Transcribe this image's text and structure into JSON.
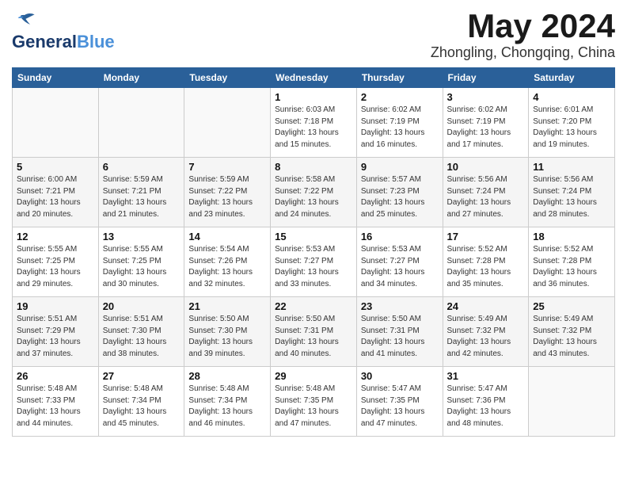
{
  "logo": {
    "text_general": "General",
    "text_blue": "Blue"
  },
  "header": {
    "title": "May 2024",
    "subtitle": "Zhongling, Chongqing, China"
  },
  "days_of_week": [
    "Sunday",
    "Monday",
    "Tuesday",
    "Wednesday",
    "Thursday",
    "Friday",
    "Saturday"
  ],
  "weeks": [
    [
      {
        "day": "",
        "info": ""
      },
      {
        "day": "",
        "info": ""
      },
      {
        "day": "",
        "info": ""
      },
      {
        "day": "1",
        "info": "Sunrise: 6:03 AM\nSunset: 7:18 PM\nDaylight: 13 hours\nand 15 minutes."
      },
      {
        "day": "2",
        "info": "Sunrise: 6:02 AM\nSunset: 7:19 PM\nDaylight: 13 hours\nand 16 minutes."
      },
      {
        "day": "3",
        "info": "Sunrise: 6:02 AM\nSunset: 7:19 PM\nDaylight: 13 hours\nand 17 minutes."
      },
      {
        "day": "4",
        "info": "Sunrise: 6:01 AM\nSunset: 7:20 PM\nDaylight: 13 hours\nand 19 minutes."
      }
    ],
    [
      {
        "day": "5",
        "info": "Sunrise: 6:00 AM\nSunset: 7:21 PM\nDaylight: 13 hours\nand 20 minutes."
      },
      {
        "day": "6",
        "info": "Sunrise: 5:59 AM\nSunset: 7:21 PM\nDaylight: 13 hours\nand 21 minutes."
      },
      {
        "day": "7",
        "info": "Sunrise: 5:59 AM\nSunset: 7:22 PM\nDaylight: 13 hours\nand 23 minutes."
      },
      {
        "day": "8",
        "info": "Sunrise: 5:58 AM\nSunset: 7:22 PM\nDaylight: 13 hours\nand 24 minutes."
      },
      {
        "day": "9",
        "info": "Sunrise: 5:57 AM\nSunset: 7:23 PM\nDaylight: 13 hours\nand 25 minutes."
      },
      {
        "day": "10",
        "info": "Sunrise: 5:56 AM\nSunset: 7:24 PM\nDaylight: 13 hours\nand 27 minutes."
      },
      {
        "day": "11",
        "info": "Sunrise: 5:56 AM\nSunset: 7:24 PM\nDaylight: 13 hours\nand 28 minutes."
      }
    ],
    [
      {
        "day": "12",
        "info": "Sunrise: 5:55 AM\nSunset: 7:25 PM\nDaylight: 13 hours\nand 29 minutes."
      },
      {
        "day": "13",
        "info": "Sunrise: 5:55 AM\nSunset: 7:25 PM\nDaylight: 13 hours\nand 30 minutes."
      },
      {
        "day": "14",
        "info": "Sunrise: 5:54 AM\nSunset: 7:26 PM\nDaylight: 13 hours\nand 32 minutes."
      },
      {
        "day": "15",
        "info": "Sunrise: 5:53 AM\nSunset: 7:27 PM\nDaylight: 13 hours\nand 33 minutes."
      },
      {
        "day": "16",
        "info": "Sunrise: 5:53 AM\nSunset: 7:27 PM\nDaylight: 13 hours\nand 34 minutes."
      },
      {
        "day": "17",
        "info": "Sunrise: 5:52 AM\nSunset: 7:28 PM\nDaylight: 13 hours\nand 35 minutes."
      },
      {
        "day": "18",
        "info": "Sunrise: 5:52 AM\nSunset: 7:28 PM\nDaylight: 13 hours\nand 36 minutes."
      }
    ],
    [
      {
        "day": "19",
        "info": "Sunrise: 5:51 AM\nSunset: 7:29 PM\nDaylight: 13 hours\nand 37 minutes."
      },
      {
        "day": "20",
        "info": "Sunrise: 5:51 AM\nSunset: 7:30 PM\nDaylight: 13 hours\nand 38 minutes."
      },
      {
        "day": "21",
        "info": "Sunrise: 5:50 AM\nSunset: 7:30 PM\nDaylight: 13 hours\nand 39 minutes."
      },
      {
        "day": "22",
        "info": "Sunrise: 5:50 AM\nSunset: 7:31 PM\nDaylight: 13 hours\nand 40 minutes."
      },
      {
        "day": "23",
        "info": "Sunrise: 5:50 AM\nSunset: 7:31 PM\nDaylight: 13 hours\nand 41 minutes."
      },
      {
        "day": "24",
        "info": "Sunrise: 5:49 AM\nSunset: 7:32 PM\nDaylight: 13 hours\nand 42 minutes."
      },
      {
        "day": "25",
        "info": "Sunrise: 5:49 AM\nSunset: 7:32 PM\nDaylight: 13 hours\nand 43 minutes."
      }
    ],
    [
      {
        "day": "26",
        "info": "Sunrise: 5:48 AM\nSunset: 7:33 PM\nDaylight: 13 hours\nand 44 minutes."
      },
      {
        "day": "27",
        "info": "Sunrise: 5:48 AM\nSunset: 7:34 PM\nDaylight: 13 hours\nand 45 minutes."
      },
      {
        "day": "28",
        "info": "Sunrise: 5:48 AM\nSunset: 7:34 PM\nDaylight: 13 hours\nand 46 minutes."
      },
      {
        "day": "29",
        "info": "Sunrise: 5:48 AM\nSunset: 7:35 PM\nDaylight: 13 hours\nand 47 minutes."
      },
      {
        "day": "30",
        "info": "Sunrise: 5:47 AM\nSunset: 7:35 PM\nDaylight: 13 hours\nand 47 minutes."
      },
      {
        "day": "31",
        "info": "Sunrise: 5:47 AM\nSunset: 7:36 PM\nDaylight: 13 hours\nand 48 minutes."
      },
      {
        "day": "",
        "info": ""
      }
    ]
  ]
}
